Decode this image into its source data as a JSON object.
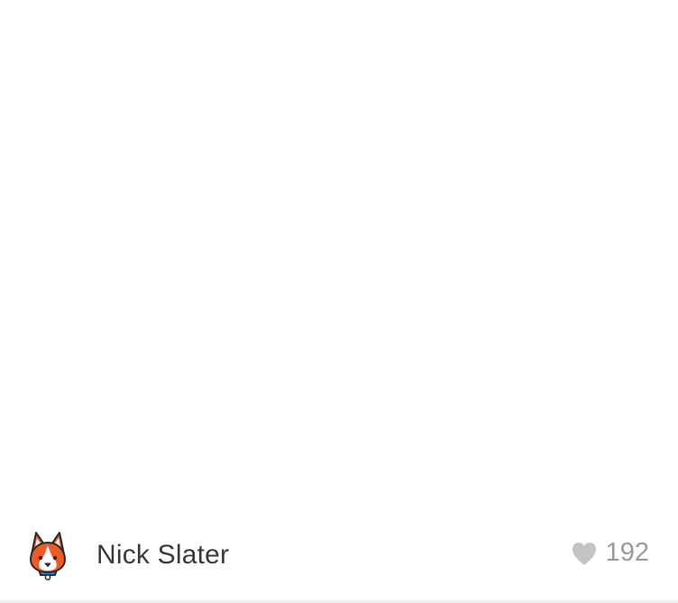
{
  "shot": {
    "author": {
      "name": "Nick Slater",
      "avatar_icon": "corgi-avatar-icon"
    },
    "likes": {
      "count": "192",
      "icon": "heart-icon"
    }
  },
  "colors": {
    "author_text": "#3a3a3a",
    "count_text": "#9b9b9b",
    "heart": "#c4c4c4",
    "avatar_orange": "#ef5a24",
    "avatar_collar": "#1f8fd6"
  }
}
